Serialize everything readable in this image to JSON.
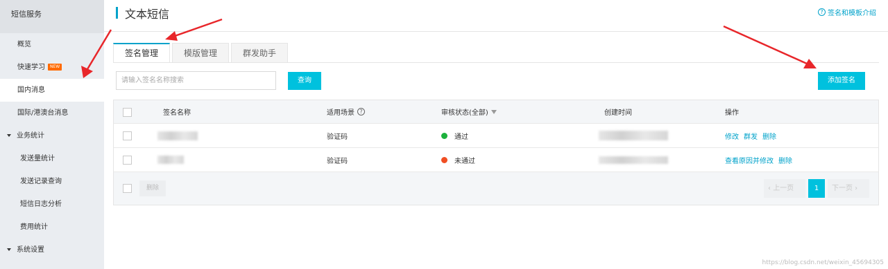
{
  "sidebar": {
    "header": "短信服务",
    "items": [
      {
        "label": "概览"
      },
      {
        "label": "快速学习",
        "badge": "NEW"
      },
      {
        "label": "国内消息"
      },
      {
        "label": "国际/港澳台消息"
      }
    ],
    "group_stats": "业务统计",
    "stats_items": [
      {
        "label": "发送量统计"
      },
      {
        "label": "发送记录查询"
      },
      {
        "label": "短信日志分析"
      },
      {
        "label": "费用统计"
      }
    ],
    "group_settings": "系统设置"
  },
  "header": {
    "title": "文本短信",
    "help_link": "签名和模板介绍"
  },
  "tabs": [
    {
      "label": "签名管理",
      "active": true
    },
    {
      "label": "模版管理",
      "active": false
    },
    {
      "label": "群发助手",
      "active": false
    }
  ],
  "search": {
    "placeholder": "请输入签名名称搜索",
    "button": "查询"
  },
  "add_button": "添加签名",
  "table": {
    "columns": {
      "name": "签名名称",
      "scene": "适用场景",
      "status": "审核状态(全部)",
      "created": "创建时间",
      "ops": "操作"
    },
    "rows": [
      {
        "scene": "验证码",
        "status": "通过",
        "status_color": "#1cb13c",
        "ops": [
          "修改",
          "群发",
          "删除"
        ]
      },
      {
        "scene": "验证码",
        "status": "未通过",
        "status_color": "#f04e23",
        "ops": [
          "查看原因并修改",
          "删除"
        ]
      }
    ]
  },
  "footer": {
    "delete": "删除",
    "prev": "上一页",
    "page": "1",
    "next": "下一页"
  },
  "watermark": "https://blog.csdn.net/weixin_45694305",
  "colors": {
    "accent": "#00c1de",
    "link": "#00a2ca",
    "arrow": "#e8262a"
  }
}
